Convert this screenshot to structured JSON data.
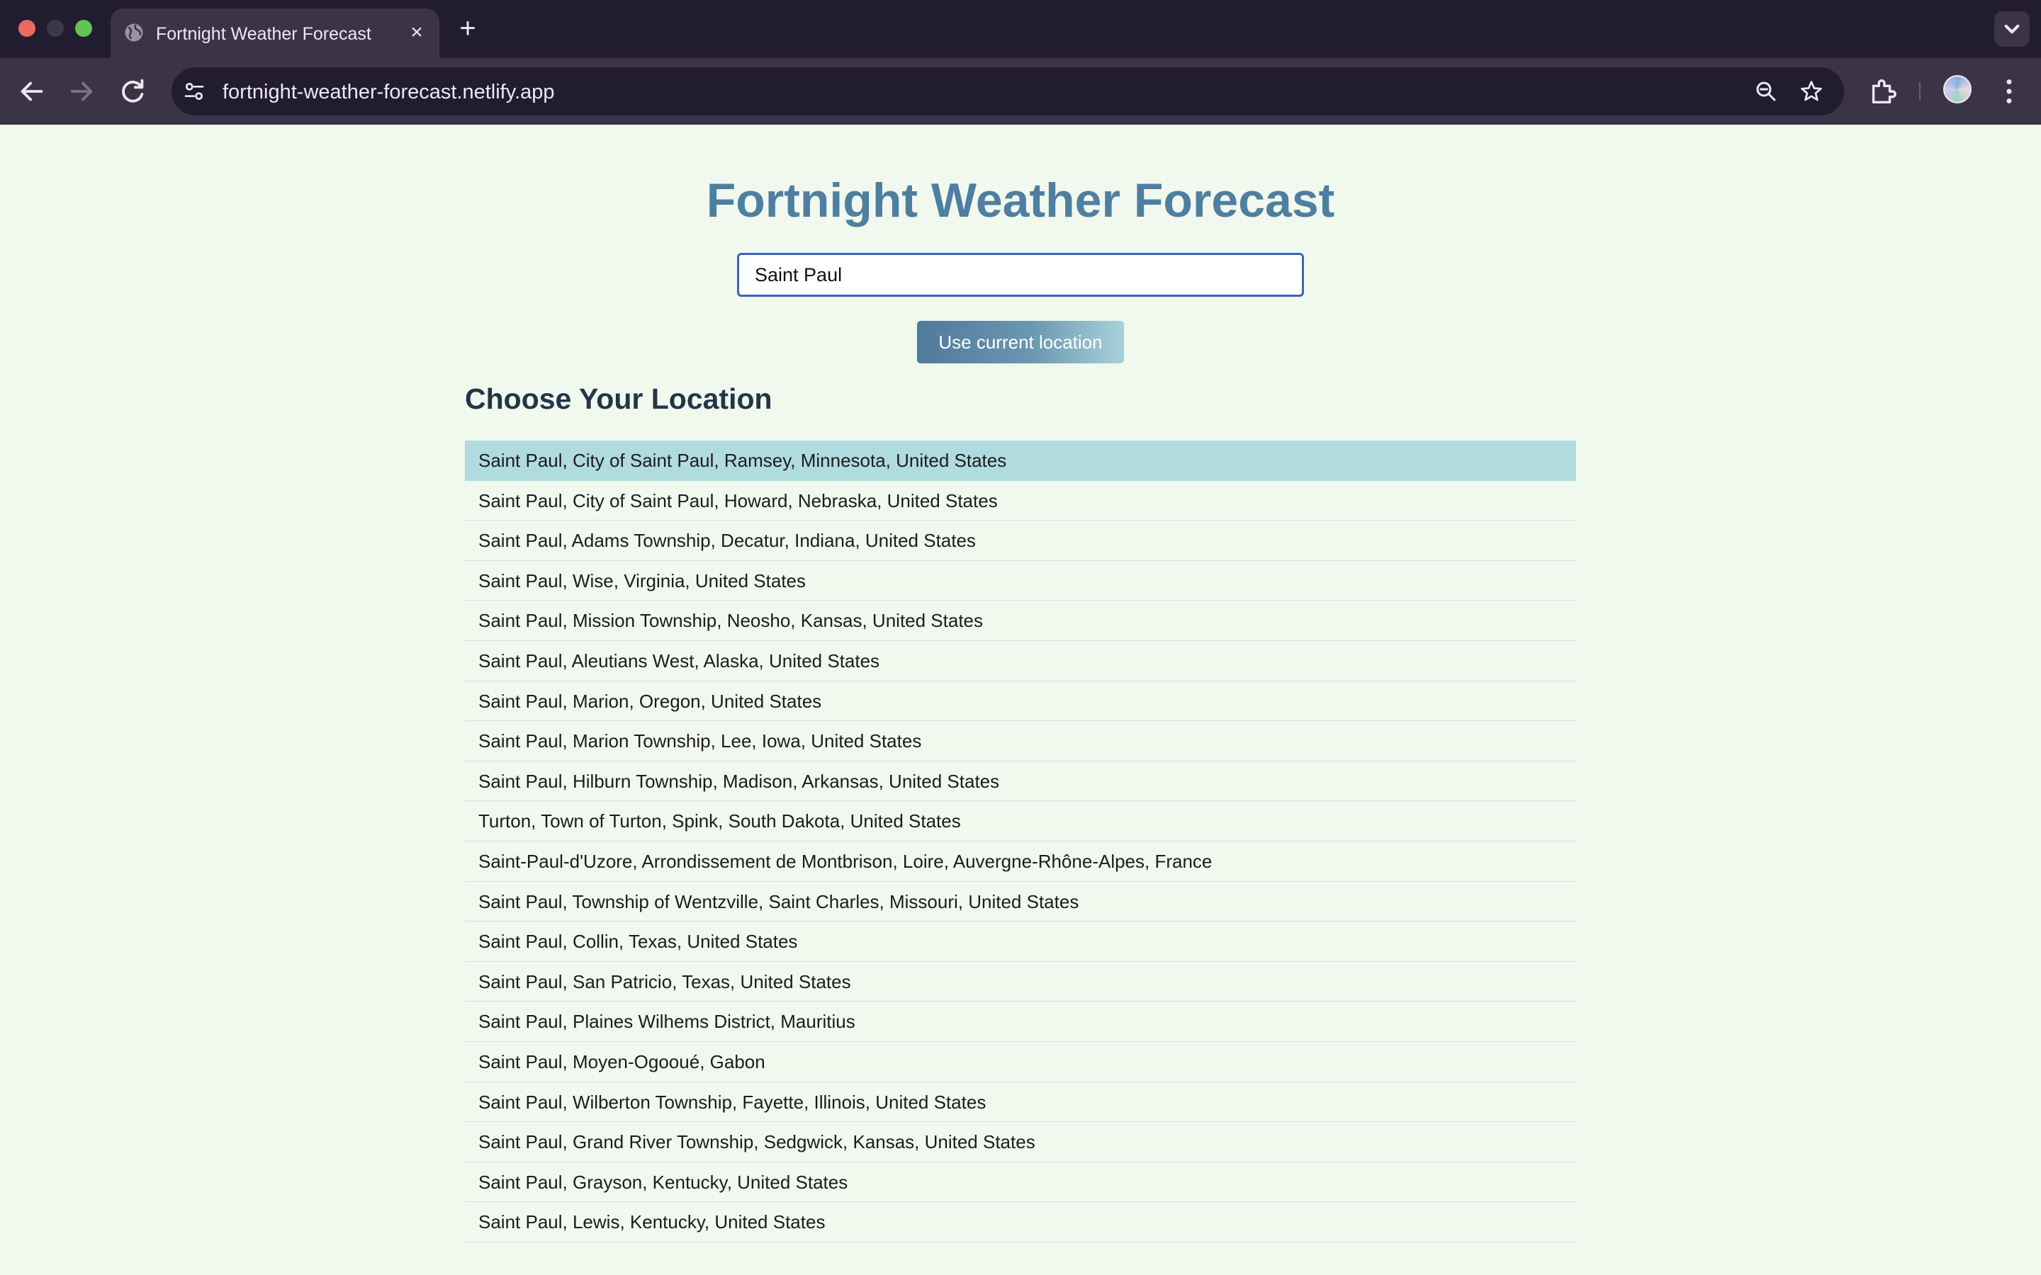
{
  "browser": {
    "tab_title": "Fortnight Weather Forecast",
    "tab_close": "×",
    "new_tab": "+",
    "url": "fortnight-weather-forecast.netlify.app"
  },
  "page": {
    "title": "Fortnight Weather Forecast",
    "search": {
      "value": "Saint Paul"
    },
    "current_location_button": "Use current location",
    "list_heading": "Choose Your Location",
    "selected_index": 0,
    "locations": [
      "Saint Paul, City of Saint Paul, Ramsey, Minnesota, United States",
      "Saint Paul, City of Saint Paul, Howard, Nebraska, United States",
      "Saint Paul, Adams Township, Decatur, Indiana, United States",
      "Saint Paul, Wise, Virginia, United States",
      "Saint Paul, Mission Township, Neosho, Kansas, United States",
      "Saint Paul, Aleutians West, Alaska, United States",
      "Saint Paul, Marion, Oregon, United States",
      "Saint Paul, Marion Township, Lee, Iowa, United States",
      "Saint Paul, Hilburn Township, Madison, Arkansas, United States",
      "Turton, Town of Turton, Spink, South Dakota, United States",
      "Saint-Paul-d'Uzore, Arrondissement de Montbrison, Loire, Auvergne-Rhône-Alpes, France",
      "Saint Paul, Township of Wentzville, Saint Charles, Missouri, United States",
      "Saint Paul, Collin, Texas, United States",
      "Saint Paul, San Patricio, Texas, United States",
      "Saint Paul, Plaines Wilhems District, Mauritius",
      "Saint Paul, Moyen-Ogooué, Gabon",
      "Saint Paul, Wilberton Township, Fayette, Illinois, United States",
      "Saint Paul, Grand River Township, Sedgwick, Kansas, United States",
      "Saint Paul, Grayson, Kentucky, United States",
      "Saint Paul, Lewis, Kentucky, United States"
    ]
  }
}
